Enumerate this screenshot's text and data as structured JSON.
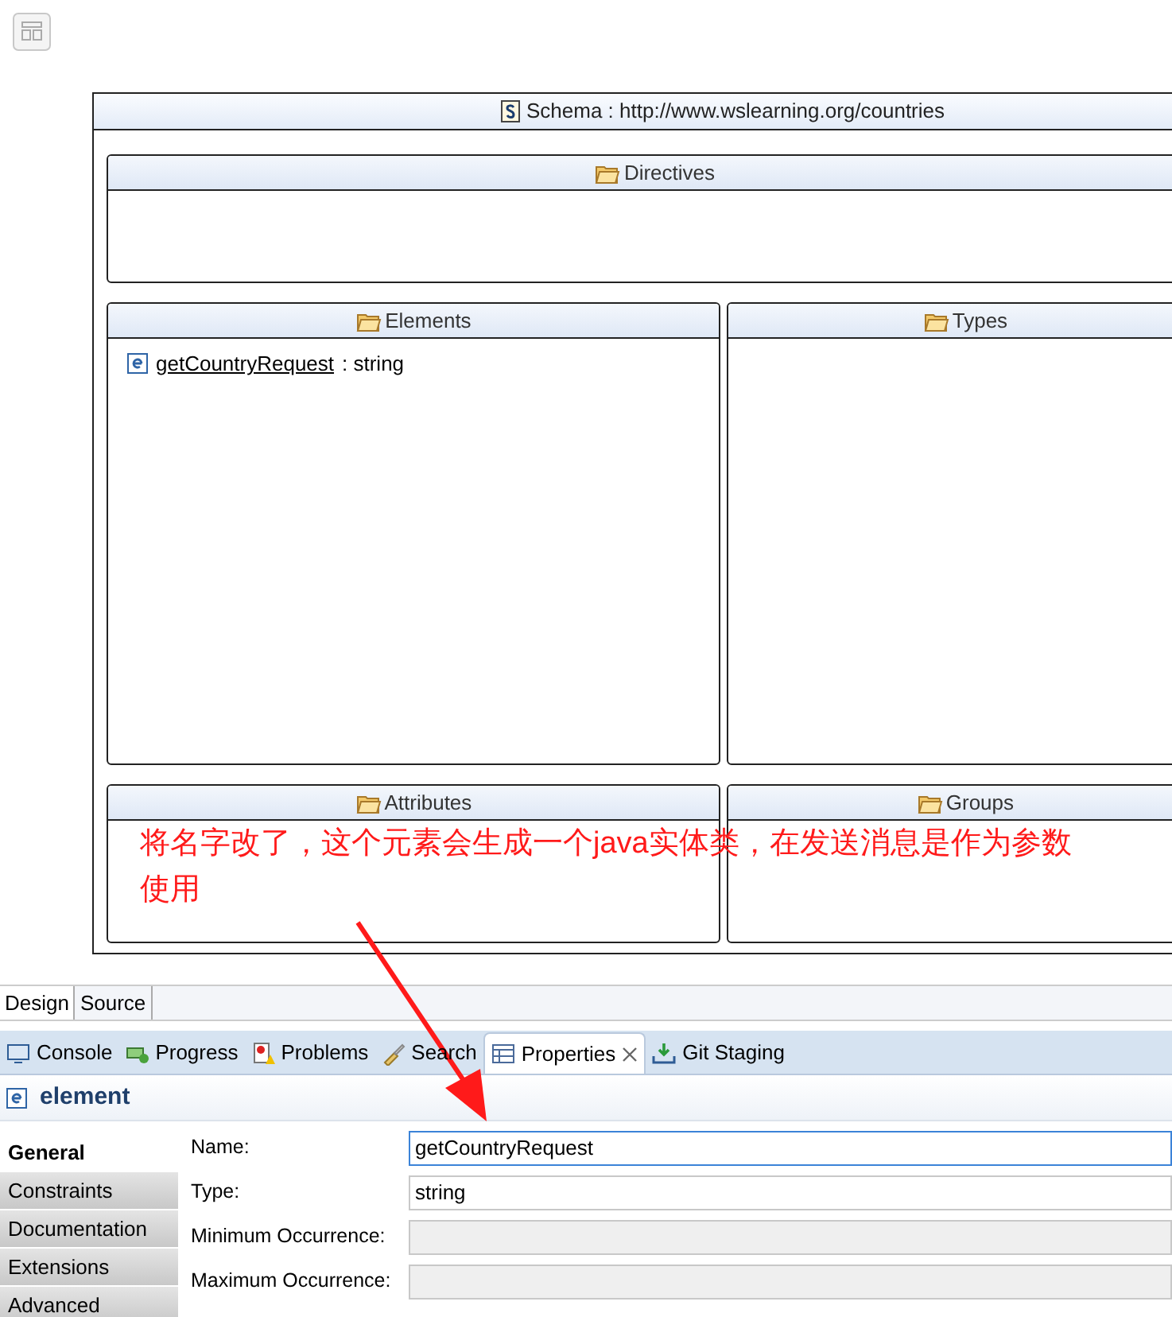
{
  "schema": {
    "title": "Schema : http://www.wslearning.org/countries"
  },
  "directives": {
    "title": "Directives"
  },
  "elements": {
    "title": "Elements",
    "items": [
      {
        "name": "getCountryRequest",
        "type": ": string"
      }
    ]
  },
  "types": {
    "title": "Types"
  },
  "attributes": {
    "title": "Attributes"
  },
  "groups": {
    "title": "Groups"
  },
  "annotation": {
    "text": "将名字改了，这个元素会生成一个java实体类，在发送消息是作为参数使用"
  },
  "editor_tabs": [
    {
      "label": "Design",
      "selected": true
    },
    {
      "label": "Source",
      "selected": false
    }
  ],
  "view_tabs": [
    {
      "label": "Console",
      "selected": false
    },
    {
      "label": "Progress",
      "selected": false
    },
    {
      "label": "Problems",
      "selected": false
    },
    {
      "label": "Search",
      "selected": false
    },
    {
      "label": "Properties",
      "selected": true
    },
    {
      "label": "Git Staging",
      "selected": false
    }
  ],
  "properties": {
    "title": "element",
    "categories": [
      {
        "label": "General",
        "selected": true
      },
      {
        "label": "Constraints",
        "selected": false
      },
      {
        "label": "Documentation",
        "selected": false
      },
      {
        "label": "Extensions",
        "selected": false
      },
      {
        "label": "Advanced",
        "selected": false
      }
    ],
    "fields": [
      {
        "label": "Name:",
        "value": "getCountryRequest",
        "disabled": false,
        "focused": true
      },
      {
        "label": "Type:",
        "value": "string",
        "disabled": false,
        "focused": false
      },
      {
        "label": "Minimum Occurrence:",
        "disabled": true,
        "focused": false
      },
      {
        "label": "Maximum Occurrence:",
        "disabled": true,
        "focused": false
      }
    ]
  }
}
